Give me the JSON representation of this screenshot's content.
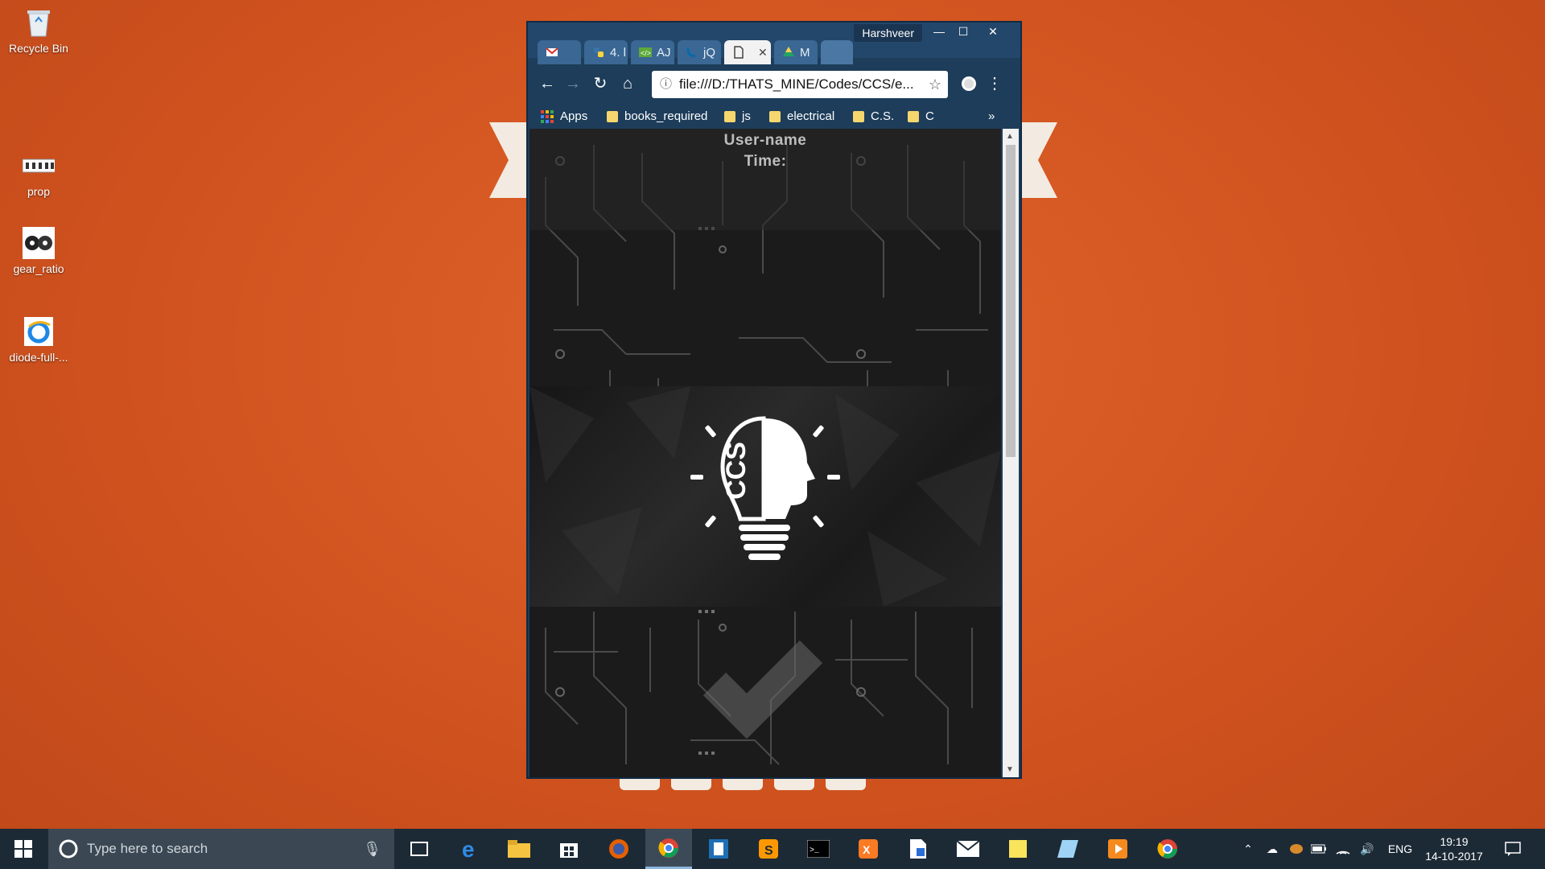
{
  "desktop": {
    "icons": [
      {
        "label": "Recycle Bin",
        "icon": "recycle-bin-icon"
      },
      {
        "label": "prop",
        "icon": "prop-file-icon"
      },
      {
        "label": "gear_ratio",
        "icon": "gear-icon"
      },
      {
        "label": "diode-full-...",
        "icon": "ie-shortcut-icon"
      }
    ]
  },
  "browser": {
    "profile_name": "Harshveer",
    "tabs": [
      {
        "label": "",
        "icon": "gmail-icon"
      },
      {
        "label": "4. l",
        "icon": "python-icon"
      },
      {
        "label": "AJ",
        "icon": "code-icon"
      },
      {
        "label": "jQ",
        "icon": "jquery-icon"
      },
      {
        "label": "",
        "icon": "file-icon",
        "active": true
      },
      {
        "label": "M",
        "icon": "drive-icon"
      }
    ],
    "url": "file:///D:/THATS_MINE/Codes/CCS/e...",
    "bookmarks": [
      "Apps",
      "books_required",
      "js",
      "electrical",
      "C.S.",
      "C"
    ],
    "bookmarks_more": "»"
  },
  "page": {
    "user_label": "User-name",
    "time_label": "Time:",
    "logo_text": "CCS"
  },
  "taskbar": {
    "search_placeholder": "Type here to search",
    "language": "ENG",
    "time": "19:19",
    "date": "14-10-2017",
    "apps": [
      "task-view",
      "edge",
      "file-explorer",
      "store",
      "firefox",
      "chrome",
      "app-7",
      "sublime",
      "cmd",
      "xampp",
      "app-11",
      "mail",
      "sticky-notes",
      "app-14",
      "media",
      "chrome-2"
    ]
  },
  "colors": {
    "desktop": "#d4561f",
    "browser_frame": "#1d3d5a",
    "page_bg": "#1b1b1b",
    "taskbar": "#1c2a36"
  }
}
